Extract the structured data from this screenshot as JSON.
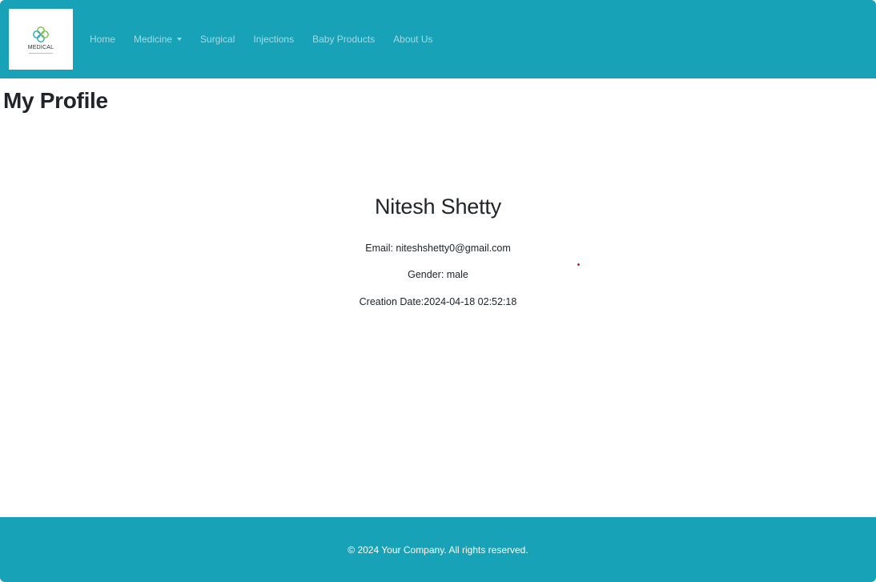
{
  "brand": {
    "logo_text": "MEDICAL",
    "logo_icon": "medical-cross-logo"
  },
  "nav": {
    "items": [
      {
        "label": "Home"
      },
      {
        "label": "Medicine",
        "has_dropdown": true
      },
      {
        "label": "Surgical"
      },
      {
        "label": "Injections"
      },
      {
        "label": "Baby Products"
      },
      {
        "label": "About Us"
      }
    ]
  },
  "page": {
    "title": "My Profile"
  },
  "profile": {
    "name": "Nitesh Shetty",
    "email_line": "Email: niteshshetty0@gmail.com",
    "gender_line": "Gender: male",
    "creation_line": "Creation Date:2024-04-18 02:52:18"
  },
  "footer": {
    "text": "© 2024 Your Company. All rights reserved."
  },
  "colors": {
    "navbar": "#17a2b8",
    "footer": "#17a2b8",
    "text": "#212529"
  }
}
